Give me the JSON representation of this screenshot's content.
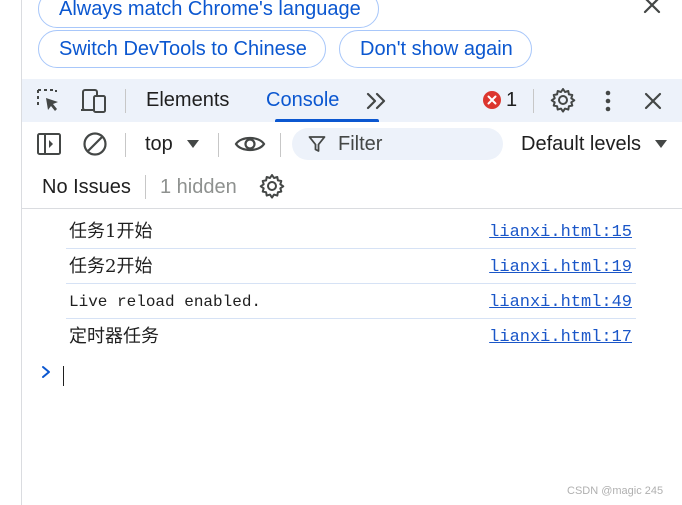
{
  "infobar": {
    "always_match_label": "Always match Chrome's language",
    "switch_chinese_label": "Switch DevTools to Chinese",
    "dont_show_label": "Don't show again",
    "close_icon": "close-icon"
  },
  "toolbar": {
    "tabs": [
      {
        "label": "Elements"
      },
      {
        "label": "Console",
        "active": true
      }
    ],
    "error_count": "1",
    "icons": [
      "inspect-element-icon",
      "device-toolbar-icon",
      "more-tabs-icon",
      "error-icon",
      "settings-gear-icon",
      "kebab-menu-icon",
      "close-icon"
    ]
  },
  "console_toolbar": {
    "context": "top",
    "filter_placeholder": "Filter",
    "levels": "Default levels"
  },
  "issues": {
    "no_issues": "No Issues",
    "hidden": "1 hidden"
  },
  "messages": [
    {
      "text": "任务1开始",
      "source": "lianxi.html:15"
    },
    {
      "text": "任务2开始",
      "source": "lianxi.html:19"
    },
    {
      "text": "Live reload enabled.",
      "source": "lianxi.html:49"
    },
    {
      "text": "定时器任务",
      "source": "lianxi.html:17"
    }
  ],
  "watermark": "CSDN @magic 245",
  "colors": {
    "accent": "#0b57d0",
    "toolbar_bg": "#edf2fa",
    "error_red": "#dc362e",
    "link": "#1a56c8"
  }
}
